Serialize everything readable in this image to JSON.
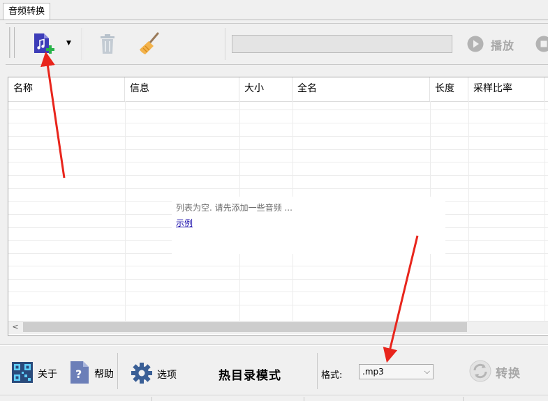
{
  "tab": {
    "label": "音频转换"
  },
  "toolbar": {
    "play_label": "播放"
  },
  "table": {
    "columns": [
      "名称",
      "信息",
      "大小",
      "全名",
      "长度",
      "采样比率"
    ]
  },
  "empty_state": {
    "message": "列表为空. 请先添加一些音频 ...",
    "link": "示例"
  },
  "scrollbar": {
    "left_arrow": "<"
  },
  "bottom": {
    "about_label": "关于",
    "help_label": "帮助",
    "options_label": "选项",
    "hot_folder_mode": "热目录模式",
    "format_label": "格式:",
    "format_value": ".mp3",
    "convert_label": "转换"
  },
  "colors": {
    "annotation_arrow": "#e8251c",
    "add_audio_icon": "#3d3db8",
    "link": "#1a0dab"
  }
}
